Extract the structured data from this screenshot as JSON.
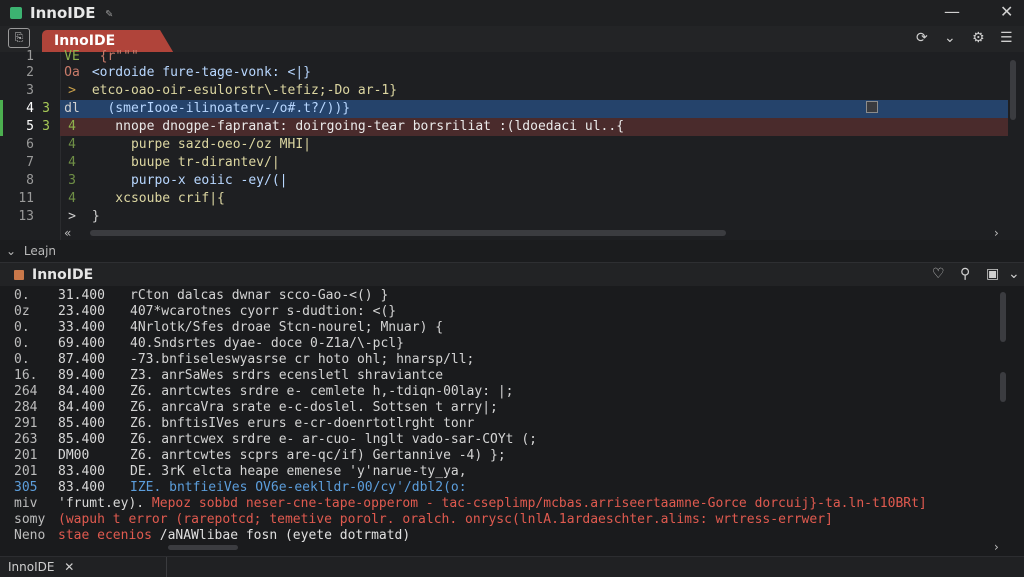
{
  "window": {
    "title": "InnoIDE",
    "pin_icon": "pin-icon",
    "minimize": "—",
    "close": "✕"
  },
  "tabs": {
    "lead_icon": "file-icon",
    "active_label": "InnoIDE",
    "right_icons": [
      "history-icon",
      "chevron-down-icon",
      "settings-icon",
      "menu-icon"
    ]
  },
  "editor": {
    "lines": [
      {
        "num": "1",
        "marker": "VE",
        "text": "  {r\"\"\"",
        "state": ""
      },
      {
        "num": "2",
        "marker": "Oa",
        "text": " <ordoide fure-tage-vonk: <|}",
        "state": ""
      },
      {
        "num": "3",
        "marker": ">",
        "text": " etco-oao-oir-esulorstr\\-tefiz;-Do ar-1}",
        "state": ""
      },
      {
        "num": "4",
        "marker": "dl",
        "text": "   (smerIooe-ilinoaterv-/o#.t?/))}",
        "state": "blue"
      },
      {
        "num": "5",
        "marker": "4",
        "text": "    nnope dnogpe-fapranat: doirgoing-tear borsriliat :(ldoedaci ul..{",
        "state": "red"
      },
      {
        "num": "6",
        "marker": "4",
        "text": "      purpe sazd-oeo-/oz MHI|",
        "state": ""
      },
      {
        "num": "7",
        "marker": "4",
        "text": "      buupe tr-dirantev/|",
        "state": ""
      },
      {
        "num": "8",
        "marker": "3",
        "text": "      purpo-x eoiic -ey/(|",
        "state": ""
      },
      {
        "num": "11",
        "marker": "4",
        "text": "    xcsoube crif|{",
        "state": ""
      },
      {
        "num": "13",
        "marker": ">",
        "text": " }",
        "state": ""
      }
    ],
    "gutter_marks": [
      "3",
      "3"
    ]
  },
  "section": {
    "label": "Leajn"
  },
  "panel": {
    "title": "InnoIDE",
    "right_icons": [
      "debug-icon",
      "search-icon",
      "save-icon",
      "chevron-down-icon"
    ]
  },
  "console": {
    "lines": [
      {
        "num": "0.",
        "time": "31.400",
        "msg": "rCton dalcas dwnar scco-Gao-<() }",
        "color": "white"
      },
      {
        "num": "0z",
        "time": "23.400",
        "msg": "407*wcarotnes cyorr s-dudtion: <(}",
        "color": "white"
      },
      {
        "num": "0.",
        "time": "33.400",
        "msg": "4Nrlotk/Sfes droae Stcn-nourel; Mnuar) {",
        "color": "white"
      },
      {
        "num": "0.",
        "time": "69.400",
        "msg": "40.Sndsrtes dyae- doce 0-Z1a/\\-pcl}",
        "color": "white"
      },
      {
        "num": "0.",
        "time": "87.400",
        "msg": "-73.bnfiseleswyasrse cr hoto ohl; hnarsp/ll;",
        "color": "white"
      },
      {
        "num": "16.",
        "time": "89.400",
        "msg": "Z3. anrSaWes srdrs ecensletl shraviantce",
        "color": "white"
      },
      {
        "num": "264",
        "time": "84.400",
        "msg": "Z6. anrtcwtes srdre e- cemlete h,-tdiqn-00lay: |;",
        "color": "white"
      },
      {
        "num": "284",
        "time": "84.400",
        "msg": "Z6. anrcaVra srate e-c-doslel. Sottsen t arry|;",
        "color": "white"
      },
      {
        "num": "291",
        "time": "85.400",
        "msg": "Z6. bnftisIVes erurs e-cr-doenrtotlrght tonr",
        "color": "white"
      },
      {
        "num": "263",
        "time": "85.400",
        "msg": "Z6. anrtcwex srdre e- ar-cuo- lnglt vado-sar-COYt (;",
        "color": "white"
      },
      {
        "num": "201",
        "time": "DM00",
        "msg": "Z6. anrtcwtes scprs are-qc/if) Gertannive -4) };",
        "color": "white"
      },
      {
        "num": "201",
        "time": "83.400",
        "msg": "DE. 3rK elcta heape emenese 'y'narue-ty_ya,",
        "color": "white"
      },
      {
        "num": "305",
        "time": "83.400",
        "msg": "IZE. bntfieiVes OV6e-eeklldr-00/cy'/dbl2(o:",
        "color": "blue"
      },
      {
        "num": "miv",
        "time": "'frumt.ey).",
        "msg": " Mepoz sobbd neser-cne-tape-opperom - tac-cseplimp/mcbas.arriseertaamne-Gorce dorcuij}-ta.ln-t10BRt]",
        "color": "mixed"
      },
      {
        "num": "somy",
        "time": "(wapuh t",
        "msg": " error (rarepotcd; temetive porolr. oralch. onrysc(lnlA.1ardaeschter.alims: wrtress-errwer]",
        "color": "red"
      },
      {
        "num": "Neno",
        "time": "stae ecenios",
        "msg": " /aNAWlibae fosn (eyete dotrmatd)",
        "color": "redwhite"
      }
    ]
  },
  "statusbar": {
    "tab_label": "InnoIDE",
    "tab_close": "✕"
  }
}
